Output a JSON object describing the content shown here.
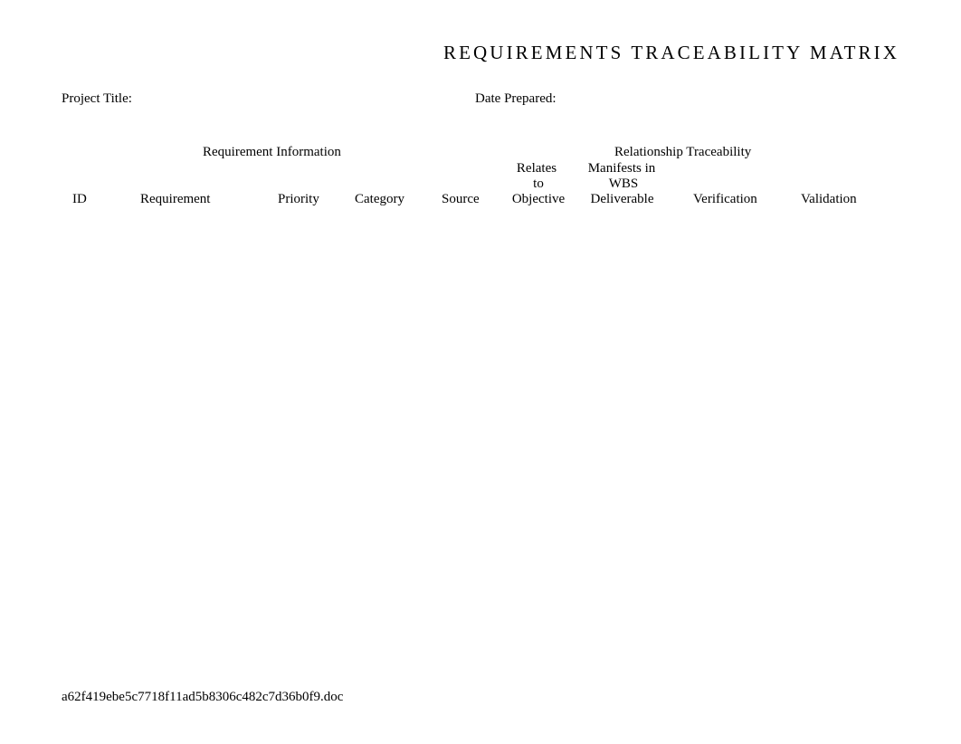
{
  "document": {
    "title": "REQUIREMENTS TRACEABILITY MATRIX",
    "fields": {
      "project_title_label": "Project Title:",
      "date_prepared_label": "Date Prepared:"
    },
    "table": {
      "group_headers": {
        "requirement_information": "Requirement Information",
        "relationship_traceability": "Relationship Traceability"
      },
      "columns": {
        "id": "ID",
        "requirement": "Requirement",
        "priority": "Priority",
        "category": "Category",
        "source": "Source",
        "relates_to_objective": [
          "Relates",
          "to",
          "Objective"
        ],
        "manifests_in_wbs_deliverable": [
          "Manifests in",
          "WBS",
          "Deliverable"
        ],
        "verification": "Verification",
        "validation": "Validation"
      }
    },
    "footer": {
      "filename": "a62f419ebe5c7718f11ad5b8306c482c7d36b0f9.doc"
    }
  }
}
